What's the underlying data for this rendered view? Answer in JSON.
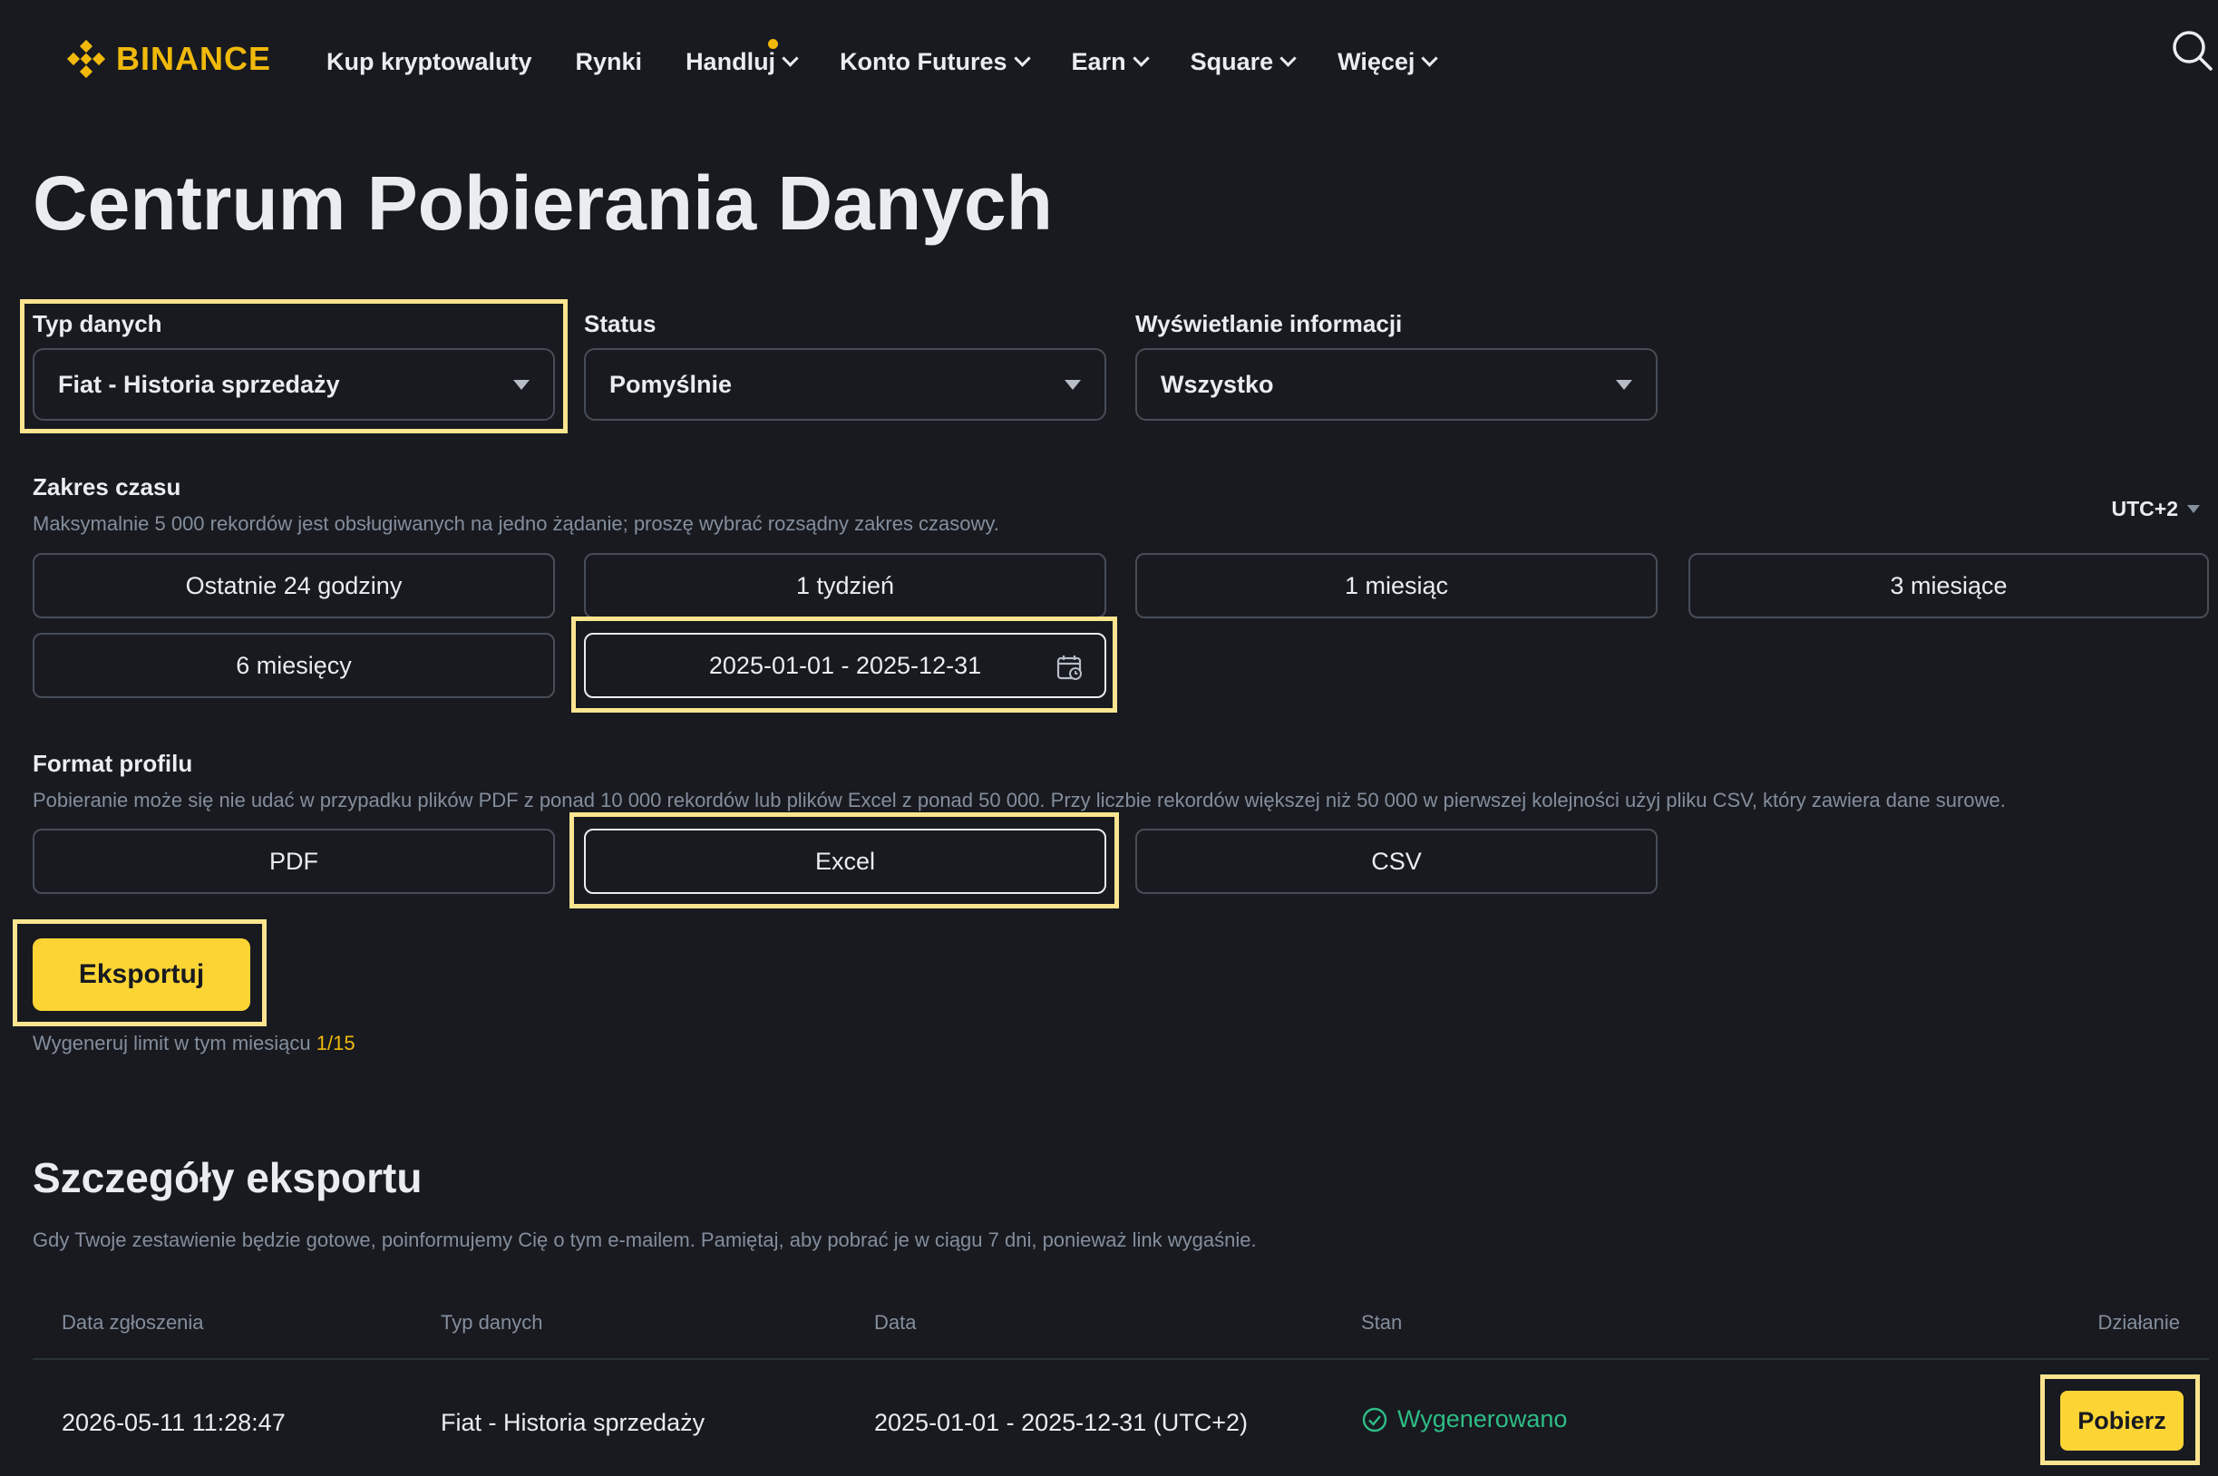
{
  "header": {
    "logo_text": "BINANCE",
    "nav": [
      {
        "label": "Kup kryptowaluty"
      },
      {
        "label": "Rynki"
      },
      {
        "label": "Handluj"
      },
      {
        "label": "Konto Futures"
      },
      {
        "label": "Earn"
      },
      {
        "label": "Square"
      },
      {
        "label": "Więcej"
      }
    ]
  },
  "page_title": "Centrum Pobierania Danych",
  "filters": {
    "data_type": {
      "label": "Typ danych",
      "value": "Fiat - Historia sprzedaży"
    },
    "status": {
      "label": "Status",
      "value": "Pomyślnie"
    },
    "display": {
      "label": "Wyświetlanie informacji",
      "value": "Wszystko"
    }
  },
  "time_range": {
    "label": "Zakres czasu",
    "hint": "Maksymalnie 5 000 rekordów jest obsługiwanych na jedno żądanie; proszę wybrać rozsądny zakres czasowy.",
    "timezone": "UTC+2",
    "options": [
      "Ostatnie 24 godziny",
      "1 tydzień",
      "1 miesiąc",
      "3 miesiące",
      "6 miesięcy"
    ],
    "custom_range": "2025-01-01 - 2025-12-31"
  },
  "format": {
    "label": "Format profilu",
    "hint": "Pobieranie może się nie udać w przypadku plików PDF z ponad 10 000 rekordów lub plików Excel z ponad 50 000. Przy liczbie rekordów większej niż 50 000 w pierwszej kolejności użyj pliku CSV, który zawiera dane surowe.",
    "options": [
      "PDF",
      "Excel",
      "CSV"
    ],
    "selected": "Excel"
  },
  "export": {
    "button": "Eksportuj",
    "limit_text": "Wygeneruj limit w tym miesiącu",
    "limit_value": "1/15"
  },
  "details": {
    "title": "Szczegóły eksportu",
    "hint": "Gdy Twoje zestawienie będzie gotowe, poinformujemy Cię o tym e-mailem. Pamiętaj, aby pobrać je w ciągu 7 dni, ponieważ link wygaśnie.",
    "columns": [
      "Data zgłoszenia",
      "Typ danych",
      "Data",
      "Stan",
      "Działanie"
    ],
    "rows": [
      {
        "submitted": "2026-05-11 11:28:47",
        "data_type": "Fiat - Historia sprzedaży",
        "date": "2025-01-01 - 2025-12-31 (UTC+2)",
        "status": "Wygenerowano",
        "action": "Pobierz"
      }
    ]
  },
  "colors": {
    "accent": "#fcd535",
    "brand": "#f0b90b",
    "success": "#2ebd85",
    "background": "#181a20",
    "highlight": "#fbe48f"
  }
}
